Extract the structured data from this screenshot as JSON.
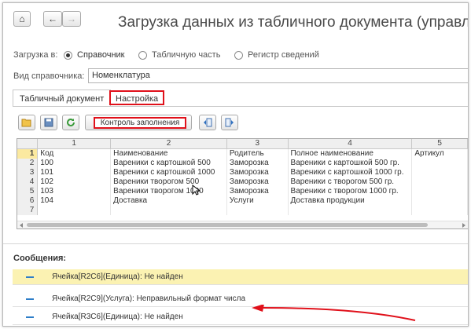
{
  "window": {
    "title": "Загрузка данных из табличного документа (управляемые"
  },
  "toolbar": {
    "home_icon": "⌂",
    "back_icon": "←",
    "forward_icon": "→"
  },
  "load_into": {
    "label": "Загрузка в:",
    "options": [
      "Справочник",
      "Табличную часть",
      "Регистр сведений"
    ],
    "selected": "Справочник"
  },
  "catalog": {
    "label": "Вид справочника:",
    "value": "Номенклатура"
  },
  "tabs": [
    {
      "label": "Табличный документ",
      "active": true
    },
    {
      "label": "Настройка",
      "highlighted": true
    }
  ],
  "grid_toolbar": {
    "check_button": "Контроль заполнения"
  },
  "grid": {
    "col_headers": [
      "1",
      "2",
      "3",
      "4",
      "5"
    ],
    "row_headers": [
      "1",
      "2",
      "3",
      "4",
      "5",
      "6",
      "7"
    ],
    "rows": [
      [
        "Код",
        "Наименование",
        "Родитель",
        "Полное наименование",
        "Артикул"
      ],
      [
        "100",
        "Вареники с картошкой 500",
        "Заморозка",
        "Вареники с картошкой  500 гр.",
        ""
      ],
      [
        "101",
        "Вареники с картошкой 1000",
        "Заморозка",
        "Вареники с картошкой 1000 гр.",
        ""
      ],
      [
        "102",
        "Вареники творогом 500",
        "Заморозка",
        "Вареники с творогом 500 гр.",
        ""
      ],
      [
        "103",
        "Вареники творогом 1000",
        "Заморозка",
        "Вареники с творогом 1000 гр.",
        ""
      ],
      [
        "104",
        "Доставка",
        "Услуги",
        "Доставка продукции",
        ""
      ],
      [
        "",
        "",
        "",
        "",
        ""
      ]
    ]
  },
  "messages": {
    "title": "Сообщения:",
    "items": [
      "Ячейка[R2C6](Единица): Не найден",
      "Ячейка[R2C9](Услуга): Неправильный формат числа",
      "Ячейка[R3C6](Единица): Не найден"
    ]
  },
  "colors": {
    "highlight": "#e0101a",
    "selected_message": "#fbf2b2",
    "message_dash": "#2d7dc8"
  }
}
